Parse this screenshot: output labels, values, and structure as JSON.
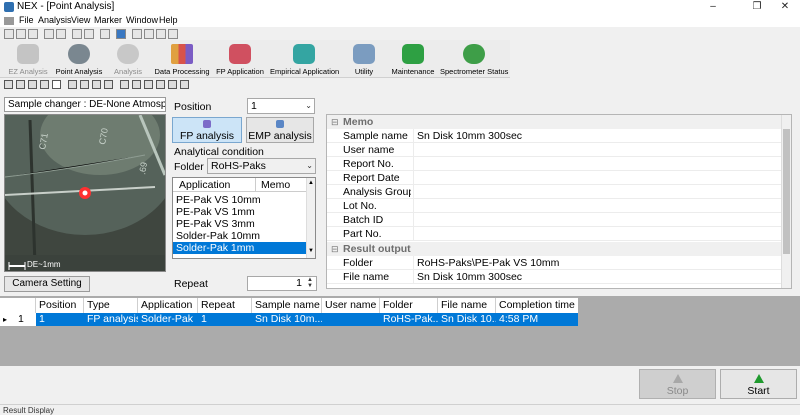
{
  "window": {
    "title": "NEX - [Point Analysis]",
    "controls": [
      "–",
      "❐",
      "✕"
    ]
  },
  "menu": [
    "File",
    "Analysis",
    "View",
    "Marker",
    "Window",
    "Help"
  ],
  "toolbar": [
    {
      "label": "EZ Analysis",
      "icon": "ez-analysis-icon",
      "enabled": false,
      "color": "#b0b0b0"
    },
    {
      "label": "Point Analysis",
      "icon": "point-analysis-icon",
      "enabled": true,
      "color": "#6f7c86"
    },
    {
      "label": "Analysis",
      "icon": "analysis-icon",
      "enabled": false,
      "color": "#b8b8b8"
    },
    {
      "label": "Data Processing",
      "icon": "data-processing-icon",
      "enabled": true,
      "color": "#d9823b"
    },
    {
      "label": "FP Application",
      "icon": "fp-application-icon",
      "enabled": true,
      "color": "#c8485a"
    },
    {
      "label": "Empirical Application",
      "icon": "empirical-application-icon",
      "enabled": true,
      "color": "#2e9c9a"
    },
    {
      "label": "Utility",
      "icon": "utility-icon",
      "enabled": true,
      "color": "#6a8fb6"
    },
    {
      "label": "Maintenance",
      "icon": "maintenance-icon",
      "enabled": true,
      "color": "#2ea043"
    },
    {
      "label": "Spectrometer Status",
      "icon": "spectrometer-status-icon",
      "enabled": true,
      "color": "#3e9e48"
    }
  ],
  "camera": {
    "sample_changer": "Sample changer : DE-None  Atmosph",
    "scale_label": "DE~1mm",
    "camera_setting_label": "Camera Setting"
  },
  "analysis": {
    "position_label": "Position",
    "position_value": "1",
    "fp_label": "FP analysis",
    "emp_label": "EMP analysis",
    "condition_label": "Analytical condition",
    "folder_label": "Folder",
    "folder_value": "RoHS-Paks",
    "app_col": "Application",
    "memo_col": "Memo",
    "applications": [
      "PE-Pak VS 10mm",
      "PE-Pak VS 1mm",
      "PE-Pak VS 3mm",
      "Solder-Pak 10mm",
      "Solder-Pak 1mm"
    ],
    "selected_application": 4,
    "repeat_label": "Repeat",
    "repeat_value": "1"
  },
  "properties": {
    "memo_category": "Memo",
    "memo_rows": [
      {
        "key": "Sample name",
        "value": "Sn Disk 10mm 300sec"
      },
      {
        "key": "User name",
        "value": ""
      },
      {
        "key": "Report No.",
        "value": ""
      },
      {
        "key": "Report Date",
        "value": ""
      },
      {
        "key": "Analysis Group",
        "value": ""
      },
      {
        "key": "Lot No.",
        "value": ""
      },
      {
        "key": "Batch ID",
        "value": ""
      },
      {
        "key": "Part No.",
        "value": ""
      }
    ],
    "result_category": "Result output",
    "result_rows": [
      {
        "key": "Folder",
        "value": "RoHS-Paks\\PE-Pak VS 10mm"
      },
      {
        "key": "File name",
        "value": "Sn Disk 10mm 300sec"
      }
    ]
  },
  "results": {
    "columns": [
      "Position",
      "Type",
      "Application",
      "Repeat",
      "Sample name",
      "User name",
      "Folder",
      "File name",
      "Completion time"
    ],
    "row_marker": "▸",
    "row_number": "1",
    "row": [
      "1",
      "FP analysis",
      "Solder-Pak",
      "1",
      "Sn Disk 10m...",
      "",
      "RoHS-Pak...",
      "Sn Disk 10...",
      "4:58 PM"
    ]
  },
  "actions": {
    "stop_label": "Stop",
    "start_label": "Start"
  },
  "status": {
    "tab_label": "Result Display"
  }
}
